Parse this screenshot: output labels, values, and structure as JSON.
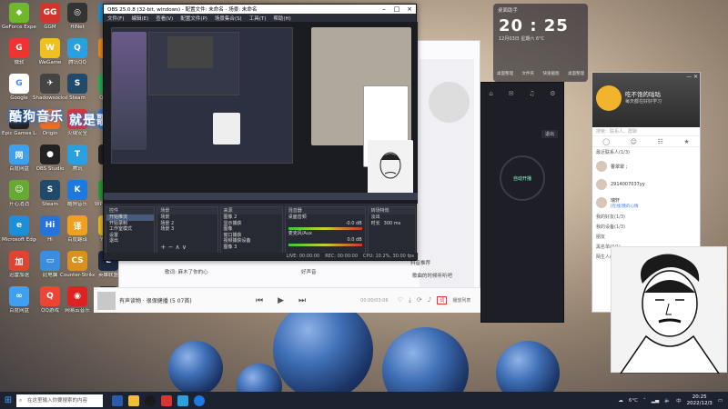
{
  "desktop": {
    "overlay_left": "酷狗音乐",
    "overlay_right": "就是歌多",
    "icons": [
      {
        "label": "GeForce Experience",
        "color": "#6fb82a",
        "glyph": "◆"
      },
      {
        "label": "GGM",
        "color": "#d2342e",
        "glyph": "GG"
      },
      {
        "label": "HiNet",
        "color": "#333",
        "glyph": "◎"
      },
      {
        "label": "Lin",
        "color": "#1e8fd8",
        "glyph": "L"
      },
      {
        "label": "微软",
        "color": "#e33",
        "glyph": "G"
      },
      {
        "label": "WeGame",
        "color": "#f0c020",
        "glyph": "W"
      },
      {
        "label": "腾讯QQ",
        "color": "#2aa0e0",
        "glyph": "Q"
      },
      {
        "label": "迅雷",
        "color": "#f28c1a",
        "glyph": "▲"
      },
      {
        "label": "Google",
        "color": "#fff",
        "glyph": "G"
      },
      {
        "label": "ShadowsocksR",
        "color": "#444",
        "glyph": "✈"
      },
      {
        "label": "Steam",
        "color": "#20496a",
        "glyph": "S"
      },
      {
        "label": "QQ音乐",
        "color": "#25b35a",
        "glyph": "♫"
      },
      {
        "label": "Epic Games Launcher",
        "color": "#222",
        "glyph": "E"
      },
      {
        "label": "Origin",
        "color": "#f56c1e",
        "glyph": "O"
      },
      {
        "label": "火绒安全",
        "color": "#d33",
        "glyph": "火"
      },
      {
        "label": "迅雷",
        "color": "#2a7be0",
        "glyph": "↓"
      },
      {
        "label": "百度网盘",
        "color": "#3fa0f0",
        "glyph": "网"
      },
      {
        "label": "OBS Studio",
        "color": "#222",
        "glyph": "●"
      },
      {
        "label": "腾讯",
        "color": "#2aa0e0",
        "glyph": "T"
      },
      {
        "label": "剪映",
        "color": "#222",
        "glyph": "✂"
      },
      {
        "label": "开心消消",
        "color": "#6a3",
        "glyph": "☺"
      },
      {
        "label": "Steam",
        "color": "#20496a",
        "glyph": "S"
      },
      {
        "label": "酷狗音乐",
        "color": "#1c79e0",
        "glyph": "K"
      },
      {
        "label": "WPS Office",
        "color": "#2c9c3c",
        "glyph": "S"
      },
      {
        "label": "Microsoft Edge",
        "color": "#1e8ed8",
        "glyph": "e"
      },
      {
        "label": "Hi",
        "color": "#2873d8",
        "glyph": "Hi"
      },
      {
        "label": "百度翻译",
        "color": "#f0a020",
        "glyph": "译"
      },
      {
        "label": "YY语音",
        "color": "#f0c020",
        "glyph": "YY"
      },
      {
        "label": "迅雷加速",
        "color": "#e04430",
        "glyph": "加"
      },
      {
        "label": "此电脑",
        "color": "#3b8de0",
        "glyph": "▭"
      },
      {
        "label": "Counter-Strike: Global",
        "color": "#d89020",
        "glyph": "CS"
      },
      {
        "label": "英雄联盟",
        "color": "#1c2a40",
        "glyph": "L"
      },
      {
        "label": "百度网盘",
        "color": "#3fa0f0",
        "glyph": "∞"
      },
      {
        "label": "QQ游戏",
        "color": "#e43",
        "glyph": "Q"
      },
      {
        "label": "网易云音乐",
        "color": "#d22",
        "glyph": "◉"
      },
      {
        "label": "英雄联盟",
        "color": "#1c2a40",
        "glyph": "L"
      }
    ]
  },
  "obs": {
    "title": "OBS 25.0.8 (32-bit, windows) - 配置文件: 未命名 - 场景: 未命名",
    "menu": [
      "文件(F)",
      "编辑(E)",
      "查看(V)",
      "配置文件(P)",
      "场景集合(S)",
      "工具(T)",
      "帮助(H)"
    ],
    "docks": {
      "controls": {
        "title": "控件",
        "items": [
          "开始推流",
          "开始录制",
          "工作室模式",
          "设置",
          "退出"
        ]
      },
      "scenes": {
        "title": "场景",
        "items": [
          "场景",
          "场景 2",
          "场景 3"
        ]
      },
      "sources": {
        "title": "来源",
        "items": [
          "图像 2",
          "显示捕获",
          "图像",
          "窗口捕获",
          "视频捕获设备",
          "图像 3"
        ]
      },
      "mixer": {
        "title": "混音器",
        "items": [
          "桌面音频",
          "麦克风/Aux"
        ],
        "values": [
          "-0.0 dB",
          "0.0 dB"
        ]
      },
      "transitions": {
        "title": "转场特效",
        "fade": "淡出",
        "duration_label": "时长",
        "duration": "300 ms"
      }
    },
    "status": [
      "LIVE: 00:00:00",
      "REC: 00:00:00",
      "CPU: 10.2%, 30.00 fps"
    ]
  },
  "music_player": {
    "song": "有声读物 · 很保健播 (5 07首)",
    "time": "00:00/03:06",
    "lyric_btn": "词",
    "playlist_btn": "播放列表"
  },
  "music_bg_texts": [
    "歌词: 麻木了你的心",
    "好声音",
    "抖音推荐",
    "歌曲的时候听听吧"
  ],
  "clock": {
    "title": "桌面助手",
    "time": "20 : 25",
    "date": "12月03日",
    "weekday": "星期六",
    "weather": "6°C",
    "actions": [
      "桌面整理",
      "文件夹",
      "快速截图",
      "桌面整理"
    ]
  },
  "vpn": {
    "label": "自动开播",
    "exit": "退出"
  },
  "qq": {
    "nick": "吃不饱的咕咕",
    "signature": "每天都在好好学习",
    "search": "搜索：联系人、群聊",
    "groups": [
      "最近联系人(1/3)",
      "我的好友(1/3)",
      "我的设备(1/3)",
      "朋友",
      "黑名单(0/1)",
      "陌生人(1/1)"
    ],
    "contacts": [
      {
        "name": "曹翠翠 ;",
        "status": ""
      },
      {
        "name": "2914007037yy",
        "status": ""
      },
      {
        "name": "瑞轩",
        "status": "[在线]我的心情"
      }
    ]
  },
  "taskbar": {
    "search_placeholder": "在这里输入你要搜索的内容",
    "weather": "6°C",
    "time": "20:25",
    "date": "2022/12/3",
    "lang": "中"
  },
  "colors": {
    "accent": "#2a6fd6",
    "obs_bg": "#2b2e38"
  }
}
